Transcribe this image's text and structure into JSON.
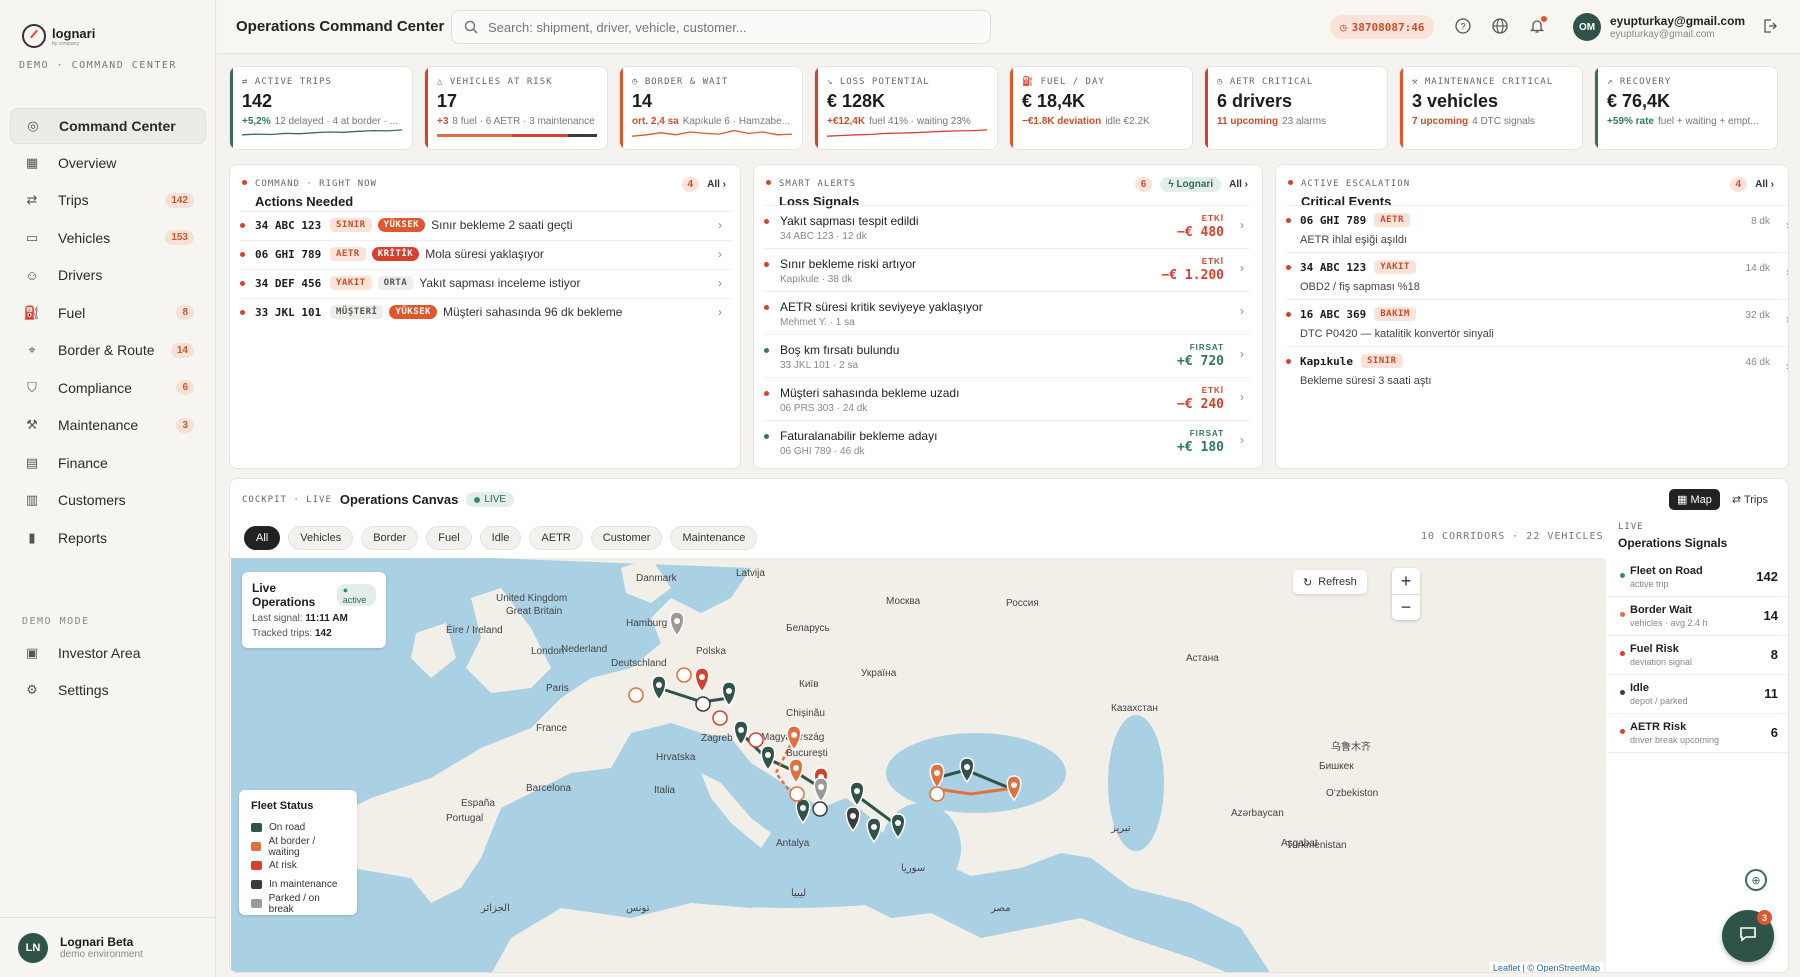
{
  "brand": {
    "name": "lognari",
    "sub": "by company",
    "tag": "DEMO · COMMAND CENTER"
  },
  "sidebar": {
    "items": [
      {
        "label": "Command Center",
        "icon": "target-icon",
        "badge": ""
      },
      {
        "label": "Overview",
        "icon": "grid-icon",
        "badge": ""
      },
      {
        "label": "Trips",
        "icon": "route-icon",
        "badge": "142"
      },
      {
        "label": "Vehicles",
        "icon": "truck-icon",
        "badge": "153"
      },
      {
        "label": "Drivers",
        "icon": "users-icon",
        "badge": ""
      },
      {
        "label": "Fuel",
        "icon": "fuel-icon",
        "badge": "8"
      },
      {
        "label": "Border & Route",
        "icon": "pin-icon",
        "badge": "14"
      },
      {
        "label": "Compliance",
        "icon": "shield-icon",
        "badge": "6"
      },
      {
        "label": "Maintenance",
        "icon": "wrench-icon",
        "badge": "3"
      },
      {
        "label": "Finance",
        "icon": "wallet-icon",
        "badge": ""
      },
      {
        "label": "Customers",
        "icon": "building-icon",
        "badge": ""
      },
      {
        "label": "Reports",
        "icon": "chart-icon",
        "badge": ""
      }
    ],
    "demo_mode_label": "DEMO MODE",
    "demo_items": [
      {
        "label": "Investor Area",
        "icon": "briefcase-icon"
      },
      {
        "label": "Settings",
        "icon": "gear-icon"
      }
    ],
    "user": {
      "initials": "LN",
      "name": "Lognari Beta",
      "sub": "demo environment"
    }
  },
  "header": {
    "title": "Operations Command Center",
    "search_placeholder": "Search: shipment, driver, vehicle, customer...",
    "timer": "38708087:46",
    "user_initials": "OM",
    "user_email": "eyupturkay@gmail.com",
    "user_email_sub": "eyupturkay@gmail.com"
  },
  "kpis": [
    {
      "label": "ACTIVE TRIPS",
      "value": "142",
      "delta": "+5,2%",
      "sub": "12 delayed · 4 at border · ...",
      "accent": "#3d6a5d",
      "delta_color": "#2f7a5a",
      "icon": "route-icon",
      "spark": [
        0.3,
        0.35,
        0.32,
        0.4,
        0.38,
        0.45,
        0.5,
        0.48,
        0.55,
        0.6,
        0.58,
        0.65
      ]
    },
    {
      "label": "VEHICLES AT RISK",
      "value": "17",
      "delta": "+3",
      "sub": "8 fuel · 6 AETR · 3 maintenance",
      "accent": "#d6402c",
      "delta_color": "#c94f2a",
      "icon": "alert-icon",
      "bars": [
        0.47,
        0.35,
        0.18
      ]
    },
    {
      "label": "BORDER & WAIT",
      "value": "14",
      "delta": "ort. 2,4 sa",
      "sub": "Kapıkule 6 · Hamzabe...",
      "accent": "#e0572e",
      "delta_color": "#c94f2a",
      "icon": "clock-icon",
      "spark": [
        0.2,
        0.3,
        0.45,
        0.3,
        0.5,
        0.4,
        0.35,
        0.6,
        0.4,
        0.5,
        0.3,
        0.35
      ]
    },
    {
      "label": "LOSS POTENTIAL",
      "value": "€ 128K",
      "delta": "+€12,4K",
      "sub": "fuel 41% · waiting 23%",
      "accent": "#d6402c",
      "delta_color": "#c94f2a",
      "icon": "trend-down-icon",
      "spark": [
        0.2,
        0.25,
        0.3,
        0.32,
        0.4,
        0.42,
        0.45,
        0.5,
        0.55,
        0.58,
        0.6,
        0.65
      ]
    },
    {
      "label": "FUEL / DAY",
      "value": "€ 18,4K",
      "delta": "−€1.8K deviation",
      "sub": "idle €2.2K",
      "accent": "#e0572e",
      "delta_color": "#c94f2a",
      "icon": "fuel-icon"
    },
    {
      "label": "AETR CRITICAL",
      "value": "6 drivers",
      "delta": "11 upcoming",
      "sub": "23 alarms",
      "accent": "#d6402c",
      "delta_color": "#c94f2a",
      "icon": "clock-icon"
    },
    {
      "label": "MAINTENANCE CRITICAL",
      "value": "3 vehicles",
      "delta": "7 upcoming",
      "sub": "4 DTC signals",
      "accent": "#e0572e",
      "delta_color": "#c94f2a",
      "icon": "wrench-icon"
    },
    {
      "label": "RECOVERY",
      "value": "€ 76,4K",
      "delta": "+59% rate",
      "sub": "fuel + waiting + empt...",
      "accent": "#3d6a5d",
      "delta_color": "#2f7a5a",
      "icon": "trend-up-icon"
    }
  ],
  "actions": {
    "eyebrow": "COMMAND · RIGHT NOW",
    "title": "Actions Needed",
    "count": "4",
    "all": "All ›",
    "rows": [
      {
        "plate": "34 ABC 123",
        "tag1": "SINIR",
        "tag1_style": "peach",
        "tag2": "YÜKSEK",
        "tag2_style": "solid",
        "text": "Sınır bekleme 2 saati geçti"
      },
      {
        "plate": "06 GHI 789",
        "tag1": "AETR",
        "tag1_style": "peach",
        "tag2": "KRİTİK",
        "tag2_style": "solidred",
        "text": "Mola süresi yaklaşıyor"
      },
      {
        "plate": "34 DEF 456",
        "tag1": "YAKIT",
        "tag1_style": "peach",
        "tag2": "ORTA",
        "tag2_style": "grey",
        "text": "Yakıt sapması inceleme istiyor"
      },
      {
        "plate": "33 JKL 101",
        "tag1": "MÜŞTERİ",
        "tag1_style": "grey",
        "tag2": "YÜKSEK",
        "tag2_style": "solid",
        "text": "Müşteri sahasında 96 dk bekleme"
      }
    ]
  },
  "signals": {
    "eyebrow": "SMART ALERTS",
    "title": "Loss Signals",
    "count": "6",
    "chip": "Lognari",
    "all": "All ›",
    "rows": [
      {
        "title": "Yakıt sapması tespit edildi",
        "sub": "34 ABC 123 · 12 dk",
        "kind": "ETKİ",
        "value": "−€ 480",
        "color": "#d6402c"
      },
      {
        "title": "Sınır bekleme riski artıyor",
        "sub": "Kapıkule · 38 dk",
        "kind": "ETKİ",
        "value": "−€ 1.200",
        "color": "#d6402c"
      },
      {
        "title": "AETR süresi kritik seviyeye yaklaşıyor",
        "sub": "Mehmet Y. · 1 sa",
        "kind": "",
        "value": "",
        "color": "#d6402c"
      },
      {
        "title": "Boş km fırsatı bulundu",
        "sub": "33 JKL 101 · 2 sa",
        "kind": "FIRSAT",
        "value": "+€ 720",
        "color": "#2f7a5a"
      },
      {
        "title": "Müşteri sahasında bekleme uzadı",
        "sub": "06 PRS 303 · 24 dk",
        "kind": "ETKİ",
        "value": "−€ 240",
        "color": "#d6402c"
      },
      {
        "title": "Faturalanabilir bekleme adayı",
        "sub": "06 GHI 789 · 46 dk",
        "kind": "FIRSAT",
        "value": "+€ 180",
        "color": "#2f7a5a"
      }
    ]
  },
  "critical": {
    "eyebrow": "ACTIVE ESCALATION",
    "title": "Critical Events",
    "count": "4",
    "all": "All ›",
    "rows": [
      {
        "plate": "06 GHI 789",
        "tag": "AETR",
        "sub": "AETR ihlal eşiği aşıldı",
        "time": "8 dk"
      },
      {
        "plate": "34 ABC 123",
        "tag": "YAKIT",
        "sub": "OBD2 / fiş sapması %18",
        "time": "14 dk"
      },
      {
        "plate": "16 ABC 369",
        "tag": "BAKIM",
        "sub": "DTC P0420 — katalitik konvertör sinyali",
        "time": "32 dk"
      },
      {
        "plate": "Kapıkule",
        "tag": "SINIR",
        "sub": "Bekleme süresi 3 saati aştı",
        "time": "46 dk"
      }
    ]
  },
  "cockpit": {
    "eyebrow": "COCKPIT · LIVE",
    "title": "Operations Canvas",
    "live": "LIVE",
    "view_map": "Map",
    "view_trips": "Trips",
    "filters": [
      "All",
      "Vehicles",
      "Border",
      "Fuel",
      "Idle",
      "AETR",
      "Customer",
      "Maintenance"
    ],
    "corridors": "10 CORRIDORS · 22 VEHICLES",
    "live_card": {
      "title": "Live Operations",
      "status": "active",
      "last_label": "Last signal:",
      "last_value": "11:11 AM",
      "tracked_label": "Tracked trips:",
      "tracked_value": "142"
    },
    "refresh": "Refresh",
    "legend": {
      "title": "Fleet Status",
      "items": [
        {
          "label": "On road",
          "color": "#2f5249"
        },
        {
          "label": "At border / waiting",
          "color": "#e0713e"
        },
        {
          "label": "At risk",
          "color": "#d6402c"
        },
        {
          "label": "In maintenance",
          "color": "#3b3b3b"
        },
        {
          "label": "Parked / on break",
          "color": "#9a9a9a"
        }
      ]
    },
    "attribution_leaflet": "Leaflet",
    "attribution_osm": "© OpenStreetMap",
    "map_labels": [
      "Danmark",
      "Latvija",
      "Hamburg",
      "United Kingdom",
      "Great Britain",
      "Éire / Ireland",
      "London",
      "Nederland",
      "Deutschland",
      "Polska",
      "Беларусь",
      "Москва",
      "Россия",
      "Paris",
      "France",
      "Київ",
      "Україна",
      "Chișinău",
      "Magyarország",
      "Zagreb",
      "Hrvatska",
      "București",
      "Italia",
      "Barcelona",
      "España",
      "Portugal",
      "Казахстан",
      "Астана",
      "Azərbaycan",
      "Türkmenistan",
      "Oʻzbekiston",
      "Бишкек",
      "Aşgabat",
      "Antalya",
      "تبریز",
      "سوریا",
      "ليبيا",
      "مصر",
      "تونس",
      "الجزائر",
      "乌鲁木齐"
    ]
  },
  "ops_signals": {
    "eyebrow": "LIVE",
    "title": "Operations Signals",
    "rows": [
      {
        "name": "Fleet on Road",
        "sub": "active trip",
        "value": "142",
        "color": "#3d8c6a"
      },
      {
        "name": "Border Wait",
        "sub": "vehicles · avg 2.4 h",
        "value": "14",
        "color": "#e0713e"
      },
      {
        "name": "Fuel Risk",
        "sub": "deviation signal",
        "value": "8",
        "color": "#d6402c"
      },
      {
        "name": "Idle",
        "sub": "depot / parked",
        "value": "11",
        "color": "#3b3b3b"
      },
      {
        "name": "AETR Risk",
        "sub": "driver break upcoming",
        "value": "6",
        "color": "#d6402c"
      }
    ]
  },
  "chat_badge": "3"
}
